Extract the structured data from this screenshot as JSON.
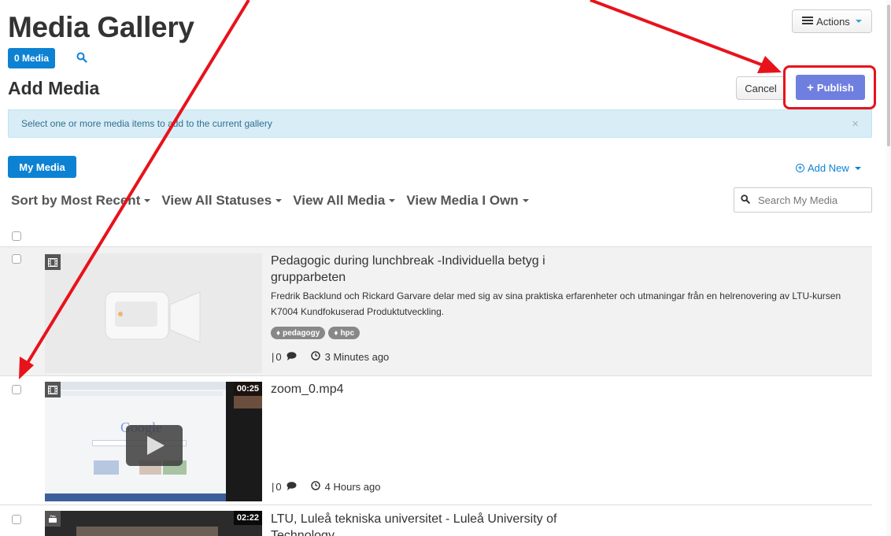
{
  "header": {
    "title": "Media Gallery",
    "actions_label": "Actions",
    "media_count_label": "0 Media"
  },
  "add_media": {
    "title": "Add Media",
    "cancel_label": "Cancel",
    "publish_label": "Publish",
    "info_message": "Select one or more media items to add to the current gallery",
    "close_glyph": "×"
  },
  "toolbar": {
    "my_media_label": "My Media",
    "add_new_label": "Add New",
    "search_placeholder": "Search My Media",
    "filters": [
      {
        "label": "Sort by Most Recent"
      },
      {
        "label": "View All Statuses"
      },
      {
        "label": "View All Media"
      },
      {
        "label": "View Media I Own"
      }
    ]
  },
  "media_items": [
    {
      "title": "Pedagogic during lunchbreak -Individuella betyg i grupparbeten",
      "description": "Fredrik Backlund och Rickard Garvare delar med sig av sina praktiska erfarenheter och utmaningar från en helrenovering av LTU-kursen K7004 Kundfokuserad Produktutveckling.",
      "tags": [
        "pedagogy",
        "hpc"
      ],
      "comments": "0",
      "time": "3 Minutes ago",
      "type_icon": "film-icon"
    },
    {
      "title": "zoom_0.mp4",
      "duration": "00:25",
      "comments": "0",
      "time": "4 Hours ago",
      "type_icon": "film-icon",
      "thumb_text": "Google"
    },
    {
      "title": "LTU, Luleå tekniska universitet - Luleå University of Technology",
      "duration": "02:22",
      "type_icon": "youtube-icon"
    }
  ],
  "colors": {
    "primary": "#0d82d3",
    "publish": "#6f7fdf",
    "annotation": "#e8121b",
    "alert_bg": "#d9edf7"
  }
}
